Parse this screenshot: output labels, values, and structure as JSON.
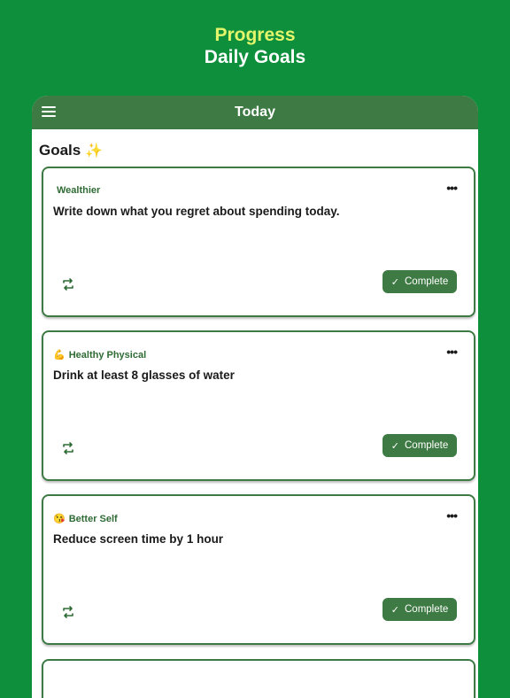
{
  "header": {
    "kicker": "Progress",
    "title": "Daily Goals"
  },
  "topbar": {
    "title": "Today"
  },
  "section": {
    "title": "Goals",
    "icon": "sparkle-icon"
  },
  "cards": [
    {
      "category": "Wealthier",
      "category_icon": "",
      "text": "Write down what you regret about spending today.",
      "button_label": "Complete"
    },
    {
      "category": "Healthy Physical",
      "category_icon": "💪",
      "text": "Drink at least 8 glasses of water",
      "button_label": "Complete"
    },
    {
      "category": "Better Self",
      "category_icon": "😘",
      "text": "Reduce screen time by 1 hour",
      "button_label": "Complete"
    }
  ],
  "colors": {
    "background": "#0e8f3c",
    "accent": "#3e7a43",
    "kicker": "#e3f56a"
  }
}
